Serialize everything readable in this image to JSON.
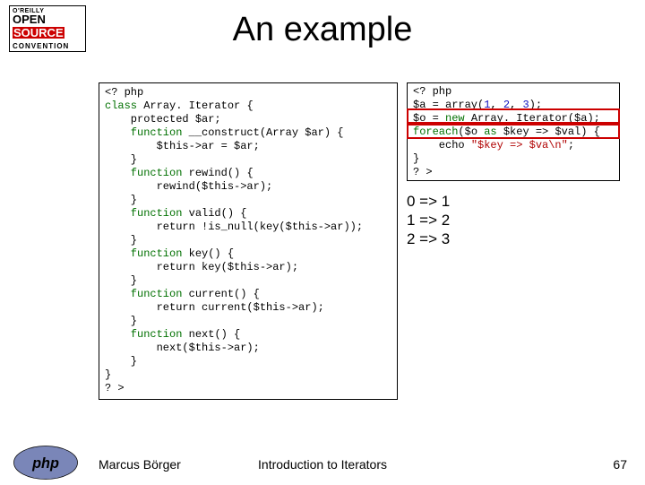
{
  "logo": {
    "small": "O'REILLY",
    "open": "OPEN",
    "source": "SOURCE",
    "conv": "CONVENTION"
  },
  "title": "An example",
  "code_left": {
    "l01a": "<? php",
    "l02a": "class ",
    "l02b": "Array. Iterator ",
    "l02c": "{",
    "l03a": "    protected $ar;",
    "l04a": "    function ",
    "l04b": "__construct",
    "l04c": "(Array $ar) {",
    "l05a": "        $this->ar = $ar;",
    "l06a": "    }",
    "l07a": "    function ",
    "l07b": "rewind",
    "l07c": "() {",
    "l08a": "        rewind($this->ar);",
    "l09a": "    }",
    "l10a": "    function ",
    "l10b": "valid",
    "l10c": "() {",
    "l11a": "        return !is_null(key($this->ar));",
    "l12a": "    }",
    "l13a": "    function ",
    "l13b": "key",
    "l13c": "() {",
    "l14a": "        return key($this->ar);",
    "l15a": "    }",
    "l16a": "    function ",
    "l16b": "current",
    "l16c": "() {",
    "l17a": "        return current($this->ar);",
    "l18a": "    }",
    "l19a": "    function ",
    "l19b": "next",
    "l19c": "() {",
    "l20a": "        next($this->ar);",
    "l21a": "    }",
    "l22a": "}",
    "l23a": "? >"
  },
  "code_right": {
    "l01a": "<? php",
    "l02a": "$a = array(",
    "l02b": "1",
    "l02c": ", ",
    "l02d": "2",
    "l02e": ", ",
    "l02f": "3",
    "l02g": ");",
    "l03a": "$o = ",
    "l03b": "new ",
    "l03c": "Array. Iterator($a);",
    "l04a": "foreach",
    "l04b": "($o ",
    "l04c": "as ",
    "l04d": "$key => $val) {",
    "l05a": "    echo ",
    "l05b": "\"$key => $va\\n\"",
    "l05c": ";",
    "l06a": "}",
    "l07a": "? >"
  },
  "output": {
    "l1": "0 => 1",
    "l2": "1 => 2",
    "l3": "2 => 3"
  },
  "footer": {
    "author": "Marcus Börger",
    "subtitle": "Introduction to Iterators",
    "pagenum": "67"
  }
}
